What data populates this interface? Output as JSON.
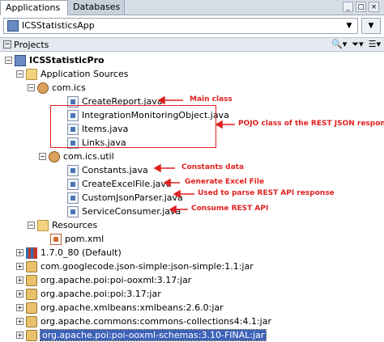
{
  "tabs": [
    {
      "label": "Applications"
    },
    {
      "label": "Databases"
    }
  ],
  "app_selector": {
    "value": "ICSStatisticsApp"
  },
  "projects_panel": {
    "label": "Projects"
  },
  "tree": {
    "project": "ICSStatisticPro",
    "application_sources": "Application Sources",
    "pkg_ics": "com.ics",
    "create_report": "CreateReport.java",
    "integration_monitoring": "IntegrationMonitoringObject.java",
    "items": "Items.java",
    "links": "Links.java",
    "pkg_util": "com.ics.util",
    "constants": "Constants.java",
    "create_excel": "CreateExcelFile.java",
    "custom_json": "CustomJsonParser.java",
    "service_consumer": "ServiceConsumer.java",
    "resources": "Resources",
    "pom": "pom.xml",
    "jdk": "1.7.0_80 (Default)",
    "jars": [
      "com.googlecode.json-simple:json-simple:1.1:jar",
      "org.apache.poi:poi-ooxml:3.17:jar",
      "org.apache.poi:poi:3.17:jar",
      "org.apache.xmlbeans:xmlbeans:2.6.0:jar",
      "org.apache.commons:commons-collections4:4.1:jar",
      "org.apache.poi:poi-ooxml-schemas:3.10-FINAL:jar"
    ]
  },
  "annotations": {
    "main_class": "Main class",
    "pojo": "POJO class of the REST JSON response",
    "constants": "Constants data",
    "excel": "Generate Excel File",
    "parse": "Used to parse REST API response",
    "consume": "Consume REST API"
  },
  "colors": {
    "annotation": "#e02020",
    "selection": "#3d62b8"
  }
}
